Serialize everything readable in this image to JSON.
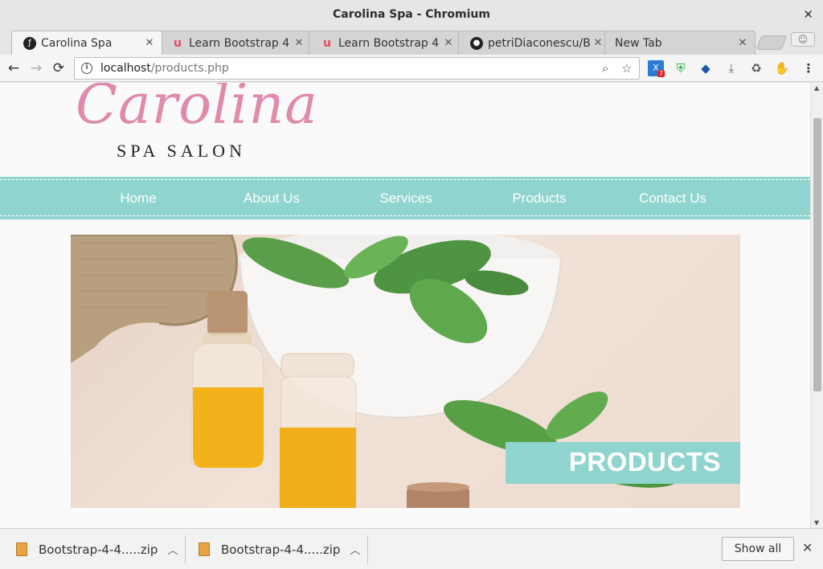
{
  "window": {
    "title": "Carolina Spa - Chromium",
    "close_glyph": "✕"
  },
  "tabs": [
    {
      "label": "Carolina Spa",
      "icon": "symfony-icon",
      "color": "#222222",
      "active": true
    },
    {
      "label": "Learn Bootstrap 4",
      "icon": "udemy-icon",
      "color": "#e84a5f",
      "active": false
    },
    {
      "label": "Learn Bootstrap 4",
      "icon": "udemy-icon",
      "color": "#e84a5f",
      "active": false
    },
    {
      "label": "petriDiaconescu/B",
      "icon": "github-icon",
      "color": "#222222",
      "active": false
    },
    {
      "label": "New Tab",
      "icon": "",
      "color": "",
      "active": false
    }
  ],
  "toolbar": {
    "back": "←",
    "forward": "→",
    "reload": "⟳",
    "url_host": "localhost",
    "url_path": "/products.php",
    "zoom_icon": "⌕",
    "star": "☆",
    "extension_badge": "7",
    "menu": "⋮"
  },
  "site": {
    "logo_script": "Carolina",
    "logo_sub": "SPA SALON",
    "nav": [
      "Home",
      "About Us",
      "Services",
      "Products",
      "Contact Us"
    ],
    "hero_label": "PRODUCTS",
    "accent_color": "#8fd4ce",
    "logo_color": "#e08aae"
  },
  "downloads": {
    "items": [
      {
        "name": "Bootstrap-4-4.....zip"
      },
      {
        "name": "Bootstrap-4-4.....zip"
      }
    ],
    "show_all": "Show all",
    "close": "✕"
  }
}
